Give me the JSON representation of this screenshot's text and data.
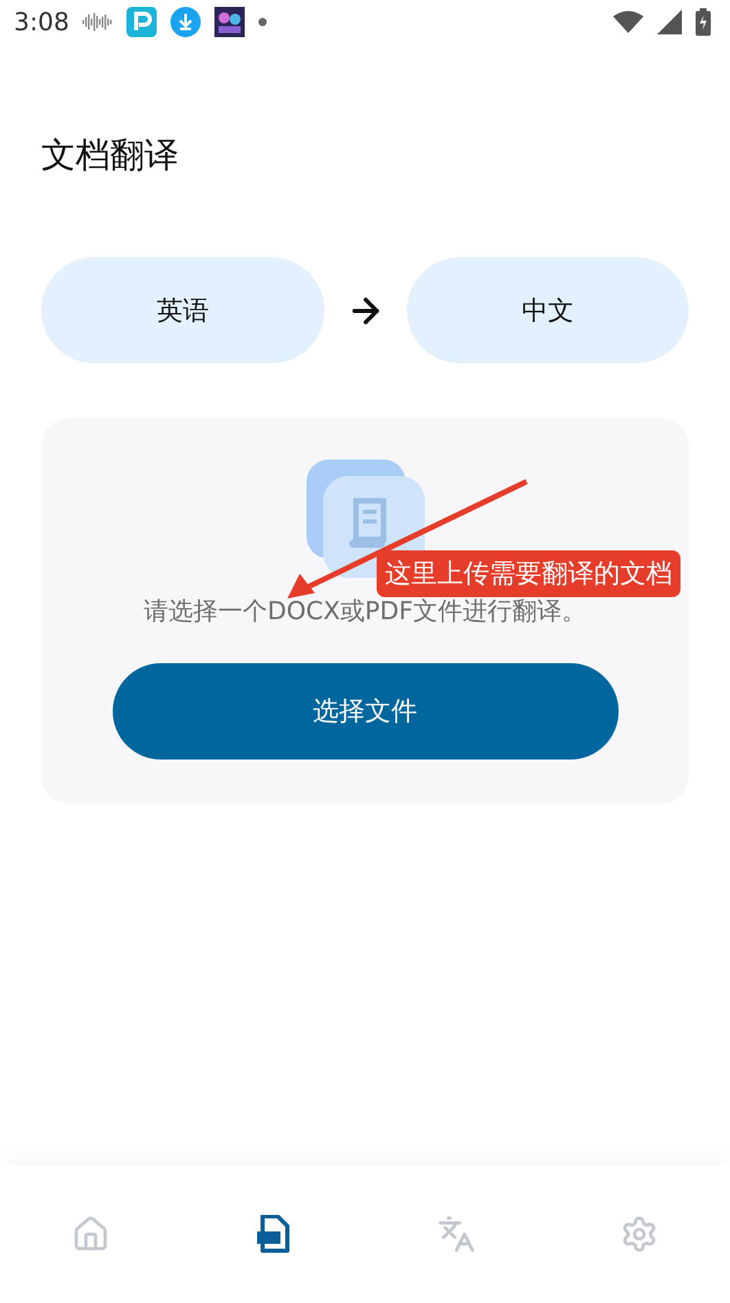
{
  "status_bar": {
    "time": "3:08"
  },
  "title": "文档翻译",
  "languages": {
    "source": "英语",
    "target": "中文"
  },
  "upload": {
    "hint": "请选择一个DOCX或PDF文件进行翻译。",
    "button": "选择文件"
  },
  "annotation": {
    "text": "这里上传需要翻译的文档"
  },
  "nav": [
    {
      "kind": "home",
      "selected": false
    },
    {
      "kind": "pdf",
      "selected": true
    },
    {
      "kind": "translate",
      "selected": false
    },
    {
      "kind": "settings",
      "selected": false
    }
  ]
}
